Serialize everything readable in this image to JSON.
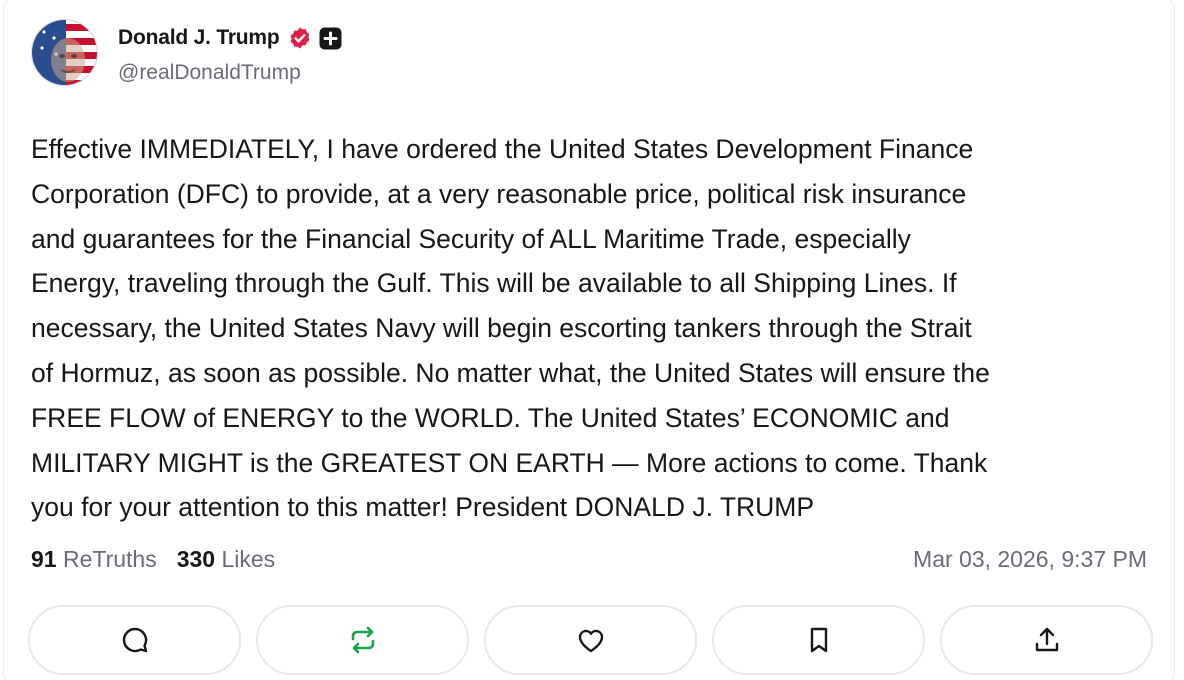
{
  "author": {
    "display_name": "Donald J. Trump",
    "handle": "@realDonaldTrump",
    "avatar_icon": "avatar-image",
    "verified_icon": "verified-badge-icon",
    "plus_icon": "plus-badge-icon"
  },
  "post": {
    "text": "Effective IMMEDIATELY, I have ordered the United States Development Finance\nCorporation (DFC) to provide, at a very reasonable price, political risk insurance\nand guarantees for the Financial Security of ALL Maritime Trade, especially\nEnergy, traveling through the Gulf. This will be available to all Shipping Lines. If\nnecessary, the United States Navy will begin escorting tankers through the Strait\nof Hormuz, as soon as possible. No matter what, the United States will ensure the\nFREE FLOW of ENERGY to the WORLD. The United States’ ECONOMIC and\nMILITARY MIGHT is the GREATEST ON EARTH — More actions to come. Thank\nyou for your attention to this matter! President DONALD J. TRUMP"
  },
  "stats": {
    "retruths_count": "91",
    "retruths_label": "ReTruths",
    "likes_count": "330",
    "likes_label": "Likes",
    "timestamp": "Mar 03, 2026, 9:37 PM"
  },
  "actions": [
    {
      "name": "reply",
      "icon": "comment-icon"
    },
    {
      "name": "retruth",
      "icon": "repost-icon",
      "color": "#16a34a"
    },
    {
      "name": "like",
      "icon": "heart-icon"
    },
    {
      "name": "bookmark",
      "icon": "bookmark-icon"
    },
    {
      "name": "share",
      "icon": "share-icon"
    }
  ],
  "colors": {
    "verified": "#e11d48",
    "retruth_accent": "#16a34a",
    "muted_text": "#6b6b78",
    "primary_text": "#17171a"
  }
}
